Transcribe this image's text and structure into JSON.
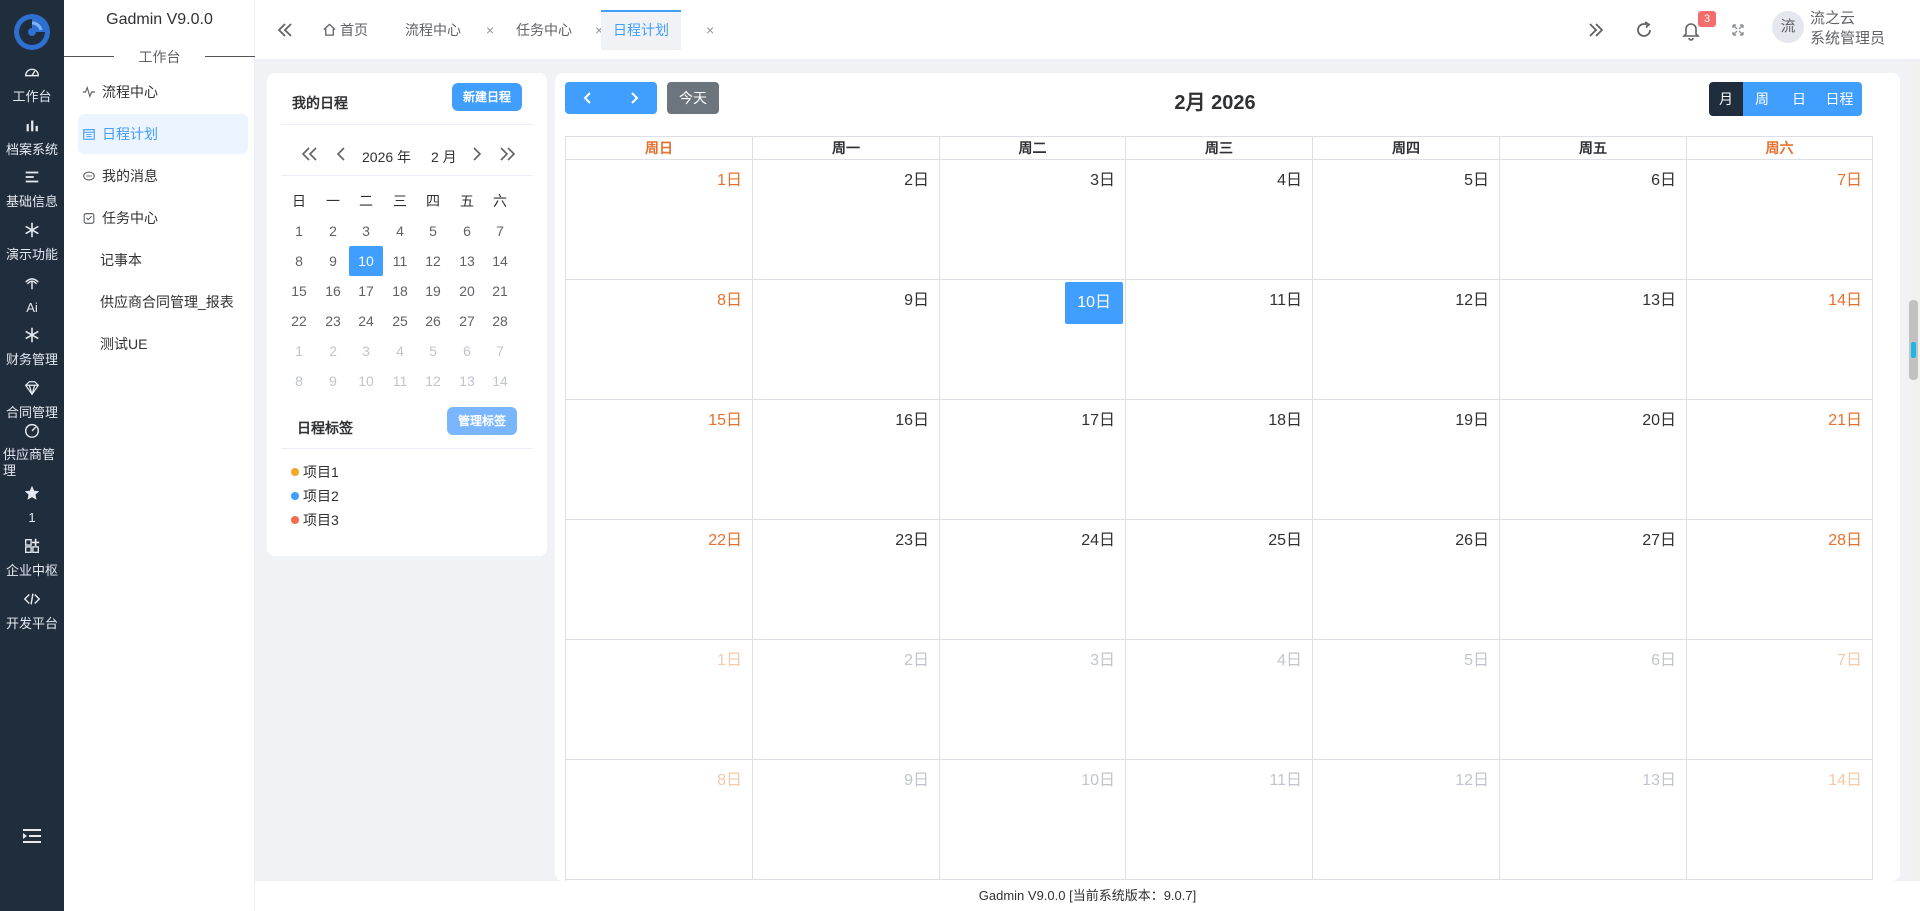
{
  "app": {
    "title": "Gadmin V9.0.0",
    "section": "工作台"
  },
  "rail": [
    {
      "label": "工作台",
      "icon": "dashboard-icon"
    },
    {
      "label": "档案系统",
      "icon": "bar-chart-icon"
    },
    {
      "label": "基础信息",
      "icon": "list-icon"
    },
    {
      "label": "演示功能",
      "icon": "snowflake-icon"
    },
    {
      "label": "Ai",
      "icon": "palm-icon"
    },
    {
      "label": "财务管理",
      "icon": "snowflake-icon"
    },
    {
      "label": "合同管理",
      "icon": "diamond-icon"
    },
    {
      "label": "供应商管理",
      "icon": "gauge-icon"
    },
    {
      "label": "1",
      "icon": "star-icon"
    },
    {
      "label": "企业中枢",
      "icon": "grid-icon"
    },
    {
      "label": "开发平台",
      "icon": "code-icon"
    }
  ],
  "menu": [
    {
      "label": "流程中心",
      "icon": "pulse-icon",
      "active": false
    },
    {
      "label": "日程计划",
      "icon": "calendar-icon",
      "active": true
    },
    {
      "label": "我的消息",
      "icon": "message-icon",
      "active": false
    },
    {
      "label": "任务中心",
      "icon": "task-icon",
      "active": false
    },
    {
      "label": "记事本",
      "icon": "",
      "active": false
    },
    {
      "label": "供应商合同管理_报表",
      "icon": "",
      "active": false
    },
    {
      "label": "测试UE",
      "icon": "",
      "active": false
    }
  ],
  "tabs": [
    {
      "label": "首页",
      "icon": "home-icon",
      "closable": false,
      "active": false
    },
    {
      "label": "流程中心",
      "closable": true,
      "active": false
    },
    {
      "label": "任务中心",
      "closable": true,
      "active": false
    },
    {
      "label": "日程计划",
      "closable": true,
      "active": true
    }
  ],
  "header": {
    "notification_count": "3",
    "avatar_text": "流",
    "user_name": "流之云",
    "user_role": "系统管理员"
  },
  "schedule_panel": {
    "title": "我的日程",
    "new_button": "新建日程",
    "mini_year": "2026 年",
    "mini_month": "2 月",
    "weekday_headers": [
      "日",
      "一",
      "二",
      "三",
      "四",
      "五",
      "六"
    ],
    "weeks": [
      [
        "1",
        "2",
        "3",
        "4",
        "5",
        "6",
        "7"
      ],
      [
        "8",
        "9",
        "10",
        "11",
        "12",
        "13",
        "14"
      ],
      [
        "15",
        "16",
        "17",
        "18",
        "19",
        "20",
        "21"
      ],
      [
        "22",
        "23",
        "24",
        "25",
        "26",
        "27",
        "28"
      ],
      [
        "1",
        "2",
        "3",
        "4",
        "5",
        "6",
        "7"
      ],
      [
        "8",
        "9",
        "10",
        "11",
        "12",
        "13",
        "14"
      ]
    ],
    "today": "10",
    "tags_title": "日程标签",
    "manage_tags_button": "管理标签",
    "tags": [
      {
        "label": "项目1",
        "color": "#f5a623"
      },
      {
        "label": "项目2",
        "color": "#409eff"
      },
      {
        "label": "项目3",
        "color": "#f56c4c"
      }
    ]
  },
  "calendar": {
    "title": "2月 2026",
    "today_button": "今天",
    "views": [
      {
        "label": "月",
        "active": true
      },
      {
        "label": "周",
        "active": false
      },
      {
        "label": "日",
        "active": false
      },
      {
        "label": "日程",
        "active": false
      }
    ],
    "weekdays": [
      "周日",
      "周一",
      "周二",
      "周三",
      "周四",
      "周五",
      "周六"
    ],
    "weeks": [
      [
        "1日",
        "2日",
        "3日",
        "4日",
        "5日",
        "6日",
        "7日"
      ],
      [
        "8日",
        "9日",
        "10日",
        "11日",
        "12日",
        "13日",
        "14日"
      ],
      [
        "15日",
        "16日",
        "17日",
        "18日",
        "19日",
        "20日",
        "21日"
      ],
      [
        "22日",
        "23日",
        "24日",
        "25日",
        "26日",
        "27日",
        "28日"
      ],
      [
        "1日",
        "2日",
        "3日",
        "4日",
        "5日",
        "6日",
        "7日"
      ],
      [
        "8日",
        "9日",
        "10日",
        "11日",
        "12日",
        "13日",
        "14日"
      ]
    ],
    "today_label": "10日",
    "colors": {
      "weekend": "#e6702e",
      "primary": "#409eff",
      "dark": "#1f2d3d"
    }
  },
  "footer": {
    "text": "Gadmin V9.0.0 [当前系统版本：9.0.7]"
  }
}
